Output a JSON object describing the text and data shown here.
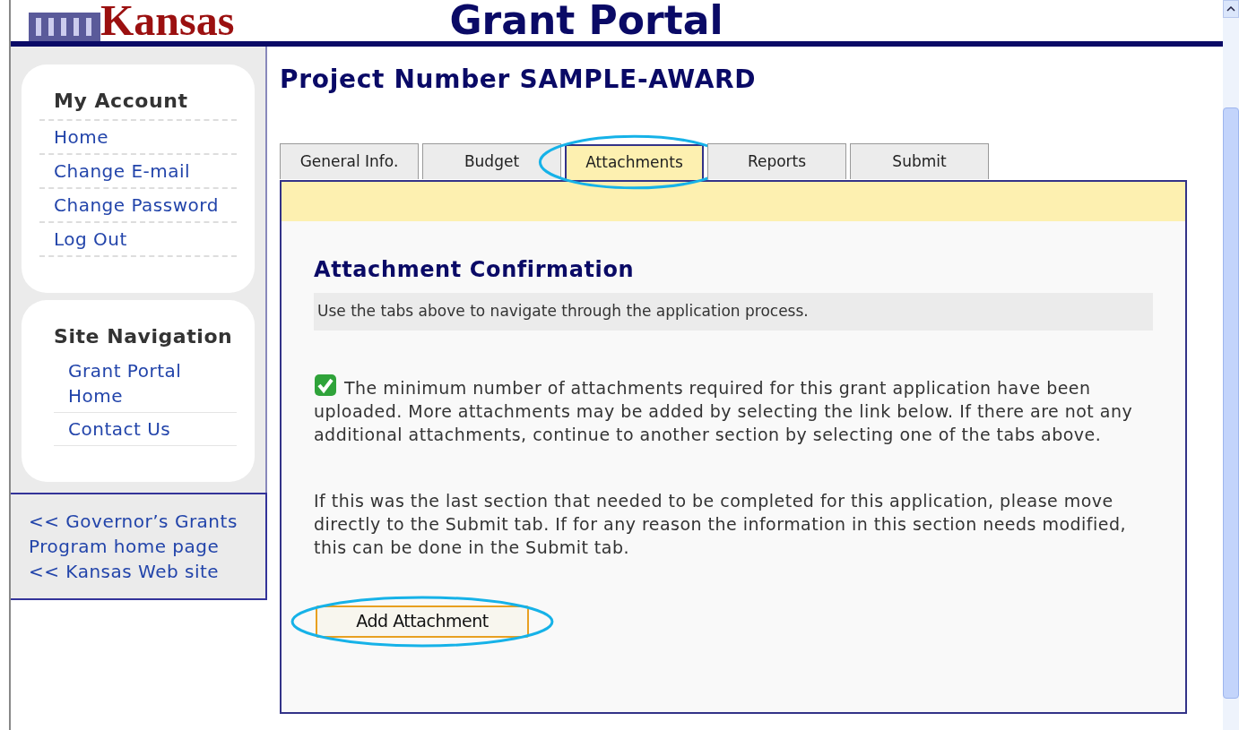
{
  "header": {
    "state_name": "Kansas",
    "portal_title": "Grant Portal"
  },
  "sidebar": {
    "sections": [
      {
        "heading": "My Account",
        "items": [
          "Home",
          "Change E-mail",
          "Change Password",
          "Log Out"
        ]
      },
      {
        "heading": "Site Navigation",
        "items": [
          "Grant Portal Home",
          "Contact Us"
        ]
      }
    ],
    "footer_links": [
      "<< Governor’s Grants Program home page",
      "<< Kansas Web site"
    ]
  },
  "page_title": "Project Number SAMPLE-AWARD",
  "tabs": [
    {
      "label": "General Info.",
      "selected": false,
      "highlighted": false
    },
    {
      "label": "Budget",
      "selected": false,
      "highlighted": false
    },
    {
      "label": "Attachments",
      "selected": true,
      "highlighted": true
    },
    {
      "label": "Reports",
      "selected": false,
      "highlighted": false
    },
    {
      "label": "Submit",
      "selected": false,
      "highlighted": false
    }
  ],
  "section_title": "Attachment Confirmation",
  "instruction": "Use the tabs above to navigate through the application process.",
  "status": {
    "complete": true,
    "message": "The minimum number of attachments required for this grant application have been uploaded. More attachments may be added by selecting the link below. If there are not any additional attachments, continue to another section by selecting one of the tabs above."
  },
  "note": "If this was the last section that needed to be completed for this application, please move directly to the Submit tab. If for any reason the information in this section needs modified, this can be done in the Submit tab.",
  "add_button": {
    "label": "Add Attachment",
    "highlighted": true
  }
}
